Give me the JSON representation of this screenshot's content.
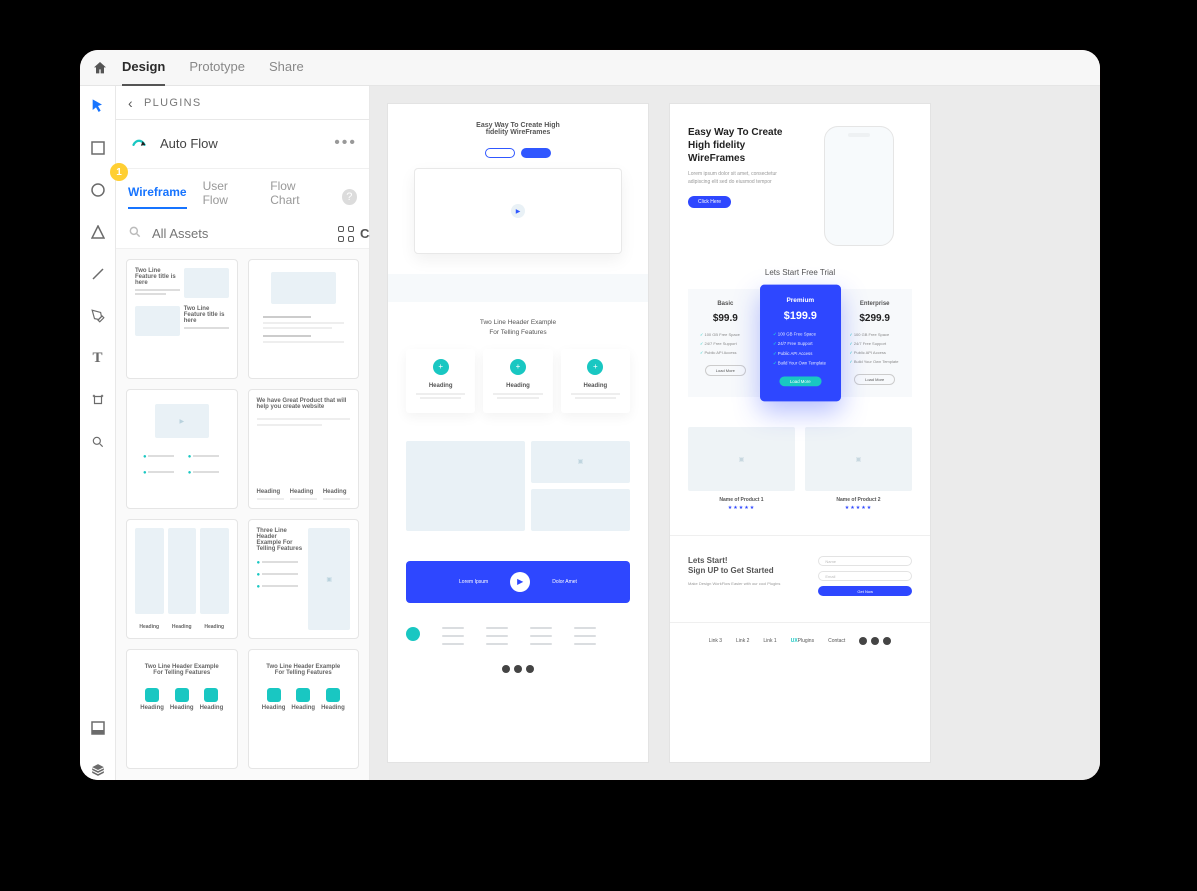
{
  "topbar": {
    "tabs": [
      "Design",
      "Prototype",
      "Share"
    ],
    "active": 0
  },
  "tools": [
    "select",
    "rectangle",
    "ellipse",
    "polygon",
    "line",
    "pen",
    "text",
    "artboard",
    "zoom"
  ],
  "panel": {
    "back_label": "PLUGINS",
    "plugin_name": "Auto Flow",
    "sub_tabs": [
      "Wireframe",
      "User Flow",
      "Flow Chart"
    ],
    "sub_active": 0,
    "badge": "1",
    "search_placeholder": "All Assets",
    "categories_label": "Categories",
    "assets": [
      {
        "title": "Two Line Feature title is here"
      },
      {
        "title": ""
      },
      {
        "title": "We have Great Product that will help you create website"
      },
      {
        "title": "Heading  Heading  Heading"
      },
      {
        "title": "Three Line Header Example For Telling Features"
      },
      {
        "title": ""
      },
      {
        "title": "Two Line Header Example For Telling Features"
      },
      {
        "title": "Two Line Header Example For Telling Features"
      }
    ]
  },
  "artboard1": {
    "hero_title": "Easy Way To Create High\nfidelity WireFrames",
    "section_title1": "Two Line Header Example",
    "section_title2": "For Telling Features",
    "card_label": "Heading",
    "cta_left": "Lorem Ipsum",
    "cta_right": "Dolor Amet"
  },
  "artboard2": {
    "hero_title": "Easy Way To Create High fidelity WireFrames",
    "hero_sub": "Lorem ipsum dolor sit amet, consectetur adipiscing elit sed do eiusmod tempor",
    "hero_btn": "Click Here",
    "pricing_title": "Lets Start Free Trial",
    "plans": [
      {
        "name": "Basic",
        "price": "$99.9",
        "btn": "Load More",
        "features": [
          "100 GB Free Space",
          "24/7 Free Support",
          "Public API Access"
        ]
      },
      {
        "name": "Premium",
        "price": "$199.9",
        "btn": "Load More",
        "features": [
          "100 GB Free Space",
          "24/7 Free Support",
          "Public API Access",
          "Build Your Own Template"
        ]
      },
      {
        "name": "Enterprise",
        "price": "$299.9",
        "btn": "Load More",
        "features": [
          "100 GB Free Space",
          "24/7 Free Support",
          "Public API Access",
          "Build Your Own Template"
        ]
      }
    ],
    "products": [
      {
        "name": "Name of Product 1"
      },
      {
        "name": "Name of Product 2"
      }
    ],
    "signup_title1": "Lets Start!",
    "signup_title2": "Sign UP to Get Started",
    "signup_sub": "Make Design WorkFlow Easier with our cool Plugins",
    "signup_fields": [
      "Name",
      "Email"
    ],
    "signup_btn": "Get Now",
    "footer_links": [
      "Link 3",
      "Link 2",
      "Link 1"
    ],
    "brand_a": "UX",
    "brand_b": "Plugins",
    "contact": "Contact"
  }
}
